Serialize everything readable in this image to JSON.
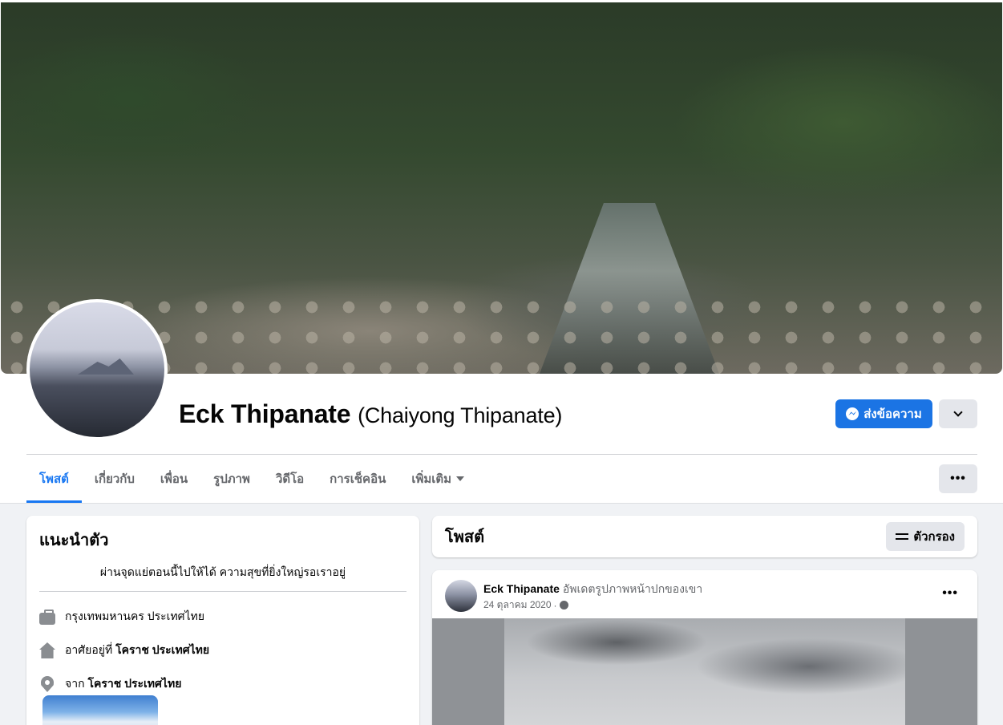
{
  "profile": {
    "name": "Eck Thipanate",
    "alt_name": "(Chaiyong Thipanate)"
  },
  "actions": {
    "message_label": "ส่งข้อความ",
    "more_dots": "•••"
  },
  "tabs": [
    {
      "label": "โพสต์",
      "active": true
    },
    {
      "label": "เกี่ยวกับ",
      "active": false
    },
    {
      "label": "เพื่อน",
      "active": false
    },
    {
      "label": "รูปภาพ",
      "active": false
    },
    {
      "label": "วิดีโอ",
      "active": false
    },
    {
      "label": "การเช็คอิน",
      "active": false
    },
    {
      "label": "เพิ่มเติม",
      "active": false
    }
  ],
  "intro": {
    "title": "แนะนำตัว",
    "bio": "ผ่านจุดแย่ตอนนี้ไปให้ได้ ความสุขที่ยิ่งใหญ่รอเราอยู่",
    "work": "กรุงเทพมหานคร ประเทศไทย",
    "lives_prefix": "อาศัยอยู่ที่",
    "lives_place": "โคราช ประเทศไทย",
    "from_prefix": "จาก",
    "from_place": "โคราช ประเทศไทย"
  },
  "posts_section": {
    "title": "โพสต์",
    "filter_label": "ตัวกรอง"
  },
  "post": {
    "author": "Eck Thipanate",
    "activity": "อัพเดตรูปภาพหน้าปกของเขา",
    "date": "24 ตุลาคม 2020",
    "separator": "·"
  },
  "icons": [
    "messenger-icon",
    "chevron-down-icon",
    "caret-down-icon",
    "more-icon",
    "briefcase-icon",
    "home-icon",
    "location-pin-icon",
    "filter-icon",
    "globe-icon"
  ],
  "colors": {
    "accent": "#1877f2",
    "button_primary": "#1b74e4",
    "secondary_text": "#65676b",
    "page_bg": "#f0f2f5"
  }
}
